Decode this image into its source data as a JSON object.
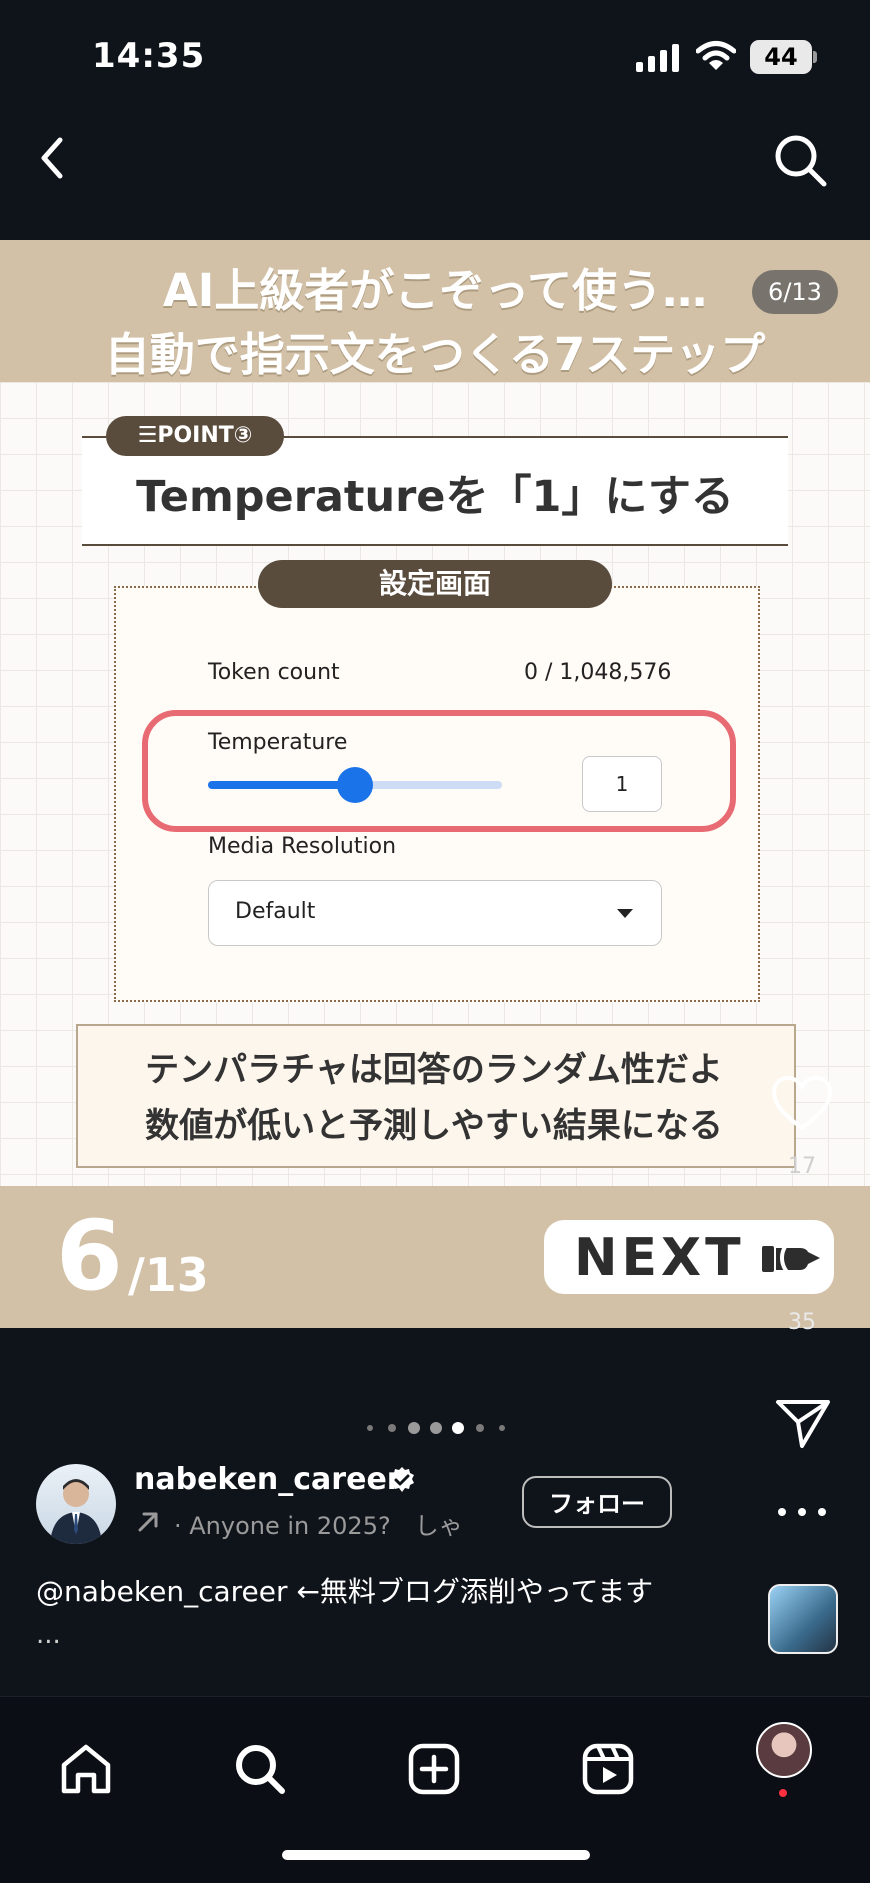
{
  "status_bar": {
    "time": "14:35",
    "battery": "44"
  },
  "post": {
    "title_line1": "AI上級者がこぞって使う…",
    "title_line2": "自動で指示文をつくる7ステップ",
    "page_badge": "6/13",
    "point_badge": "☰POINT③",
    "point_title": "Temperatureを「1」にする",
    "settings_label": "設定画面",
    "token_label": "Token count",
    "token_value": "0 / 1,048,576",
    "temperature_label": "Temperature",
    "temperature_value": "1",
    "temperature_level": 0.5,
    "media_label": "Media Resolution",
    "media_value": "Default",
    "note_line1": "テンパラチャは回答のランダム性だよ",
    "note_line2": "数値が低いと予測しやすい結果になる",
    "footer_page": "6",
    "footer_total": "/13",
    "next_label": "NEXT"
  },
  "actions": {
    "like_count": "17",
    "comment_count": "35"
  },
  "carousel": {
    "dot_count": 7,
    "active_index": 4
  },
  "author": {
    "username": "nabeken_career",
    "audio_text": "· Anyone in 2025?　しゃ",
    "follow_label": "フォロー"
  },
  "caption": {
    "text": "@nabeken_career ←無料ブログ添削やってます",
    "more": "..."
  },
  "colors": {
    "beige": "#d2c1a6",
    "brown": "#5a4c3d",
    "highlight": "#e86a72",
    "slider": "#1a73e8",
    "notification": "#ff3040"
  },
  "icons": [
    "back-chevron-icon",
    "search-icon",
    "heart-icon",
    "comment-icon",
    "send-icon",
    "more-icon",
    "verified-icon",
    "home-icon",
    "plus-square-icon",
    "reels-icon"
  ]
}
